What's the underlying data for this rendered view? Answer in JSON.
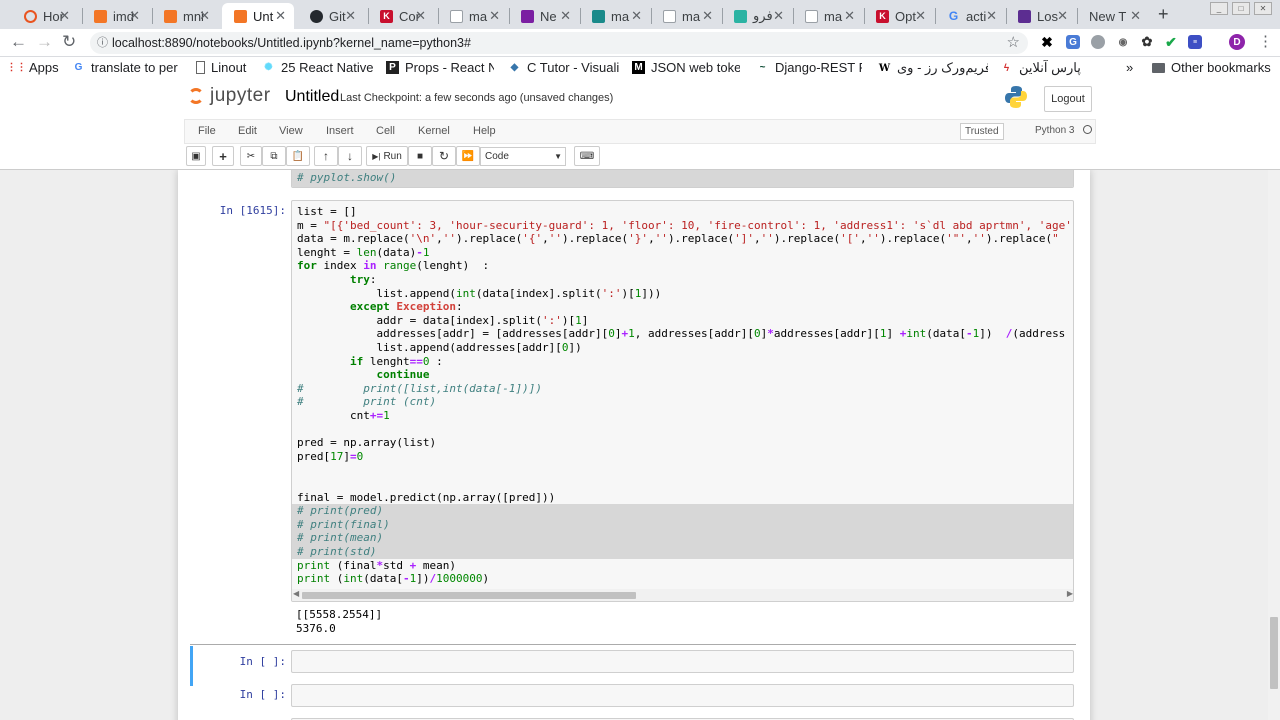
{
  "browser": {
    "tabs": [
      {
        "label": "Hor",
        "icon": "ubuntu-icon",
        "color": "#e95420"
      },
      {
        "label": "imd",
        "icon": "jupyter-icon",
        "color": "#f37626"
      },
      {
        "label": "mni",
        "icon": "jupyter-icon",
        "color": "#f37626"
      },
      {
        "label": "Unt",
        "icon": "jupyter-icon",
        "color": "#f37626"
      },
      {
        "label": "Git",
        "icon": "github-icon",
        "color": "#24292e"
      },
      {
        "label": "Cor",
        "icon": "kaggle-icon",
        "color": "#c8102e"
      },
      {
        "label": "ma",
        "icon": "document-icon",
        "color": "#9aa0a6"
      },
      {
        "label": "Ne",
        "icon": "site-icon",
        "color": "#7b1fa2"
      },
      {
        "label": "ma",
        "icon": "site-icon",
        "color": "#1a8a8a"
      },
      {
        "label": "ma",
        "icon": "document-icon",
        "color": "#9aa0a6"
      },
      {
        "label": "فرو",
        "icon": "site-icon",
        "color": "#2bb3a3"
      },
      {
        "label": "ma",
        "icon": "document-icon",
        "color": "#9aa0a6"
      },
      {
        "label": "Opt",
        "icon": "kaggle-icon",
        "color": "#c8102e"
      },
      {
        "label": "acti",
        "icon": "google-icon",
        "color": "#4285f4"
      },
      {
        "label": "Los",
        "icon": "graduation-icon",
        "color": "#5c2d91"
      },
      {
        "label": "New T",
        "icon": "",
        "color": ""
      }
    ],
    "address": "localhost:8890/notebooks/Untitled.ipynb?kernel_name=python3#",
    "bookmarks": [
      {
        "label": "Apps",
        "icon": "apps-grid-icon"
      },
      {
        "label": "translate to per",
        "icon": "google-icon"
      },
      {
        "label": "Linout",
        "icon": "document-icon"
      },
      {
        "label": "25 React Native",
        "icon": "react-icon"
      },
      {
        "label": "Props - React N",
        "icon": "site-icon"
      },
      {
        "label": "C Tutor - Visuali",
        "icon": "python-icon"
      },
      {
        "label": "JSON web toke",
        "icon": "medium-icon"
      },
      {
        "label": "Django-REST Fr",
        "icon": "site-icon"
      },
      {
        "label": "فریم‌ورک رز - وی",
        "icon": "wikipedia-icon"
      },
      {
        "label": "پارس آنلاین",
        "icon": "site-icon"
      },
      {
        "label": "»",
        "icon": ""
      },
      {
        "label": "Other bookmarks",
        "icon": "folder-icon"
      }
    ]
  },
  "jupyter": {
    "logo": "jupyter",
    "notebook_name": "Untitled",
    "checkpoint": "Last Checkpoint: a few seconds ago  (unsaved changes)",
    "logout": "Logout",
    "menu": [
      "File",
      "Edit",
      "View",
      "Insert",
      "Cell",
      "Kernel",
      "Help"
    ],
    "trusted": "Trusted",
    "kernel": "Python 3",
    "run_label": "Run",
    "cell_type": "Code"
  },
  "cells": [
    {
      "prompt": "In [1615]:",
      "output": [
        "[[5558.2554]]",
        "5376.0"
      ]
    },
    {
      "prompt": "In [ ]:"
    },
    {
      "prompt": "In [ ]:"
    }
  ],
  "code_top": "# pyplot.show()",
  "colors": {
    "accent": "#42a5f5",
    "prompt_in": "#303f9f"
  }
}
